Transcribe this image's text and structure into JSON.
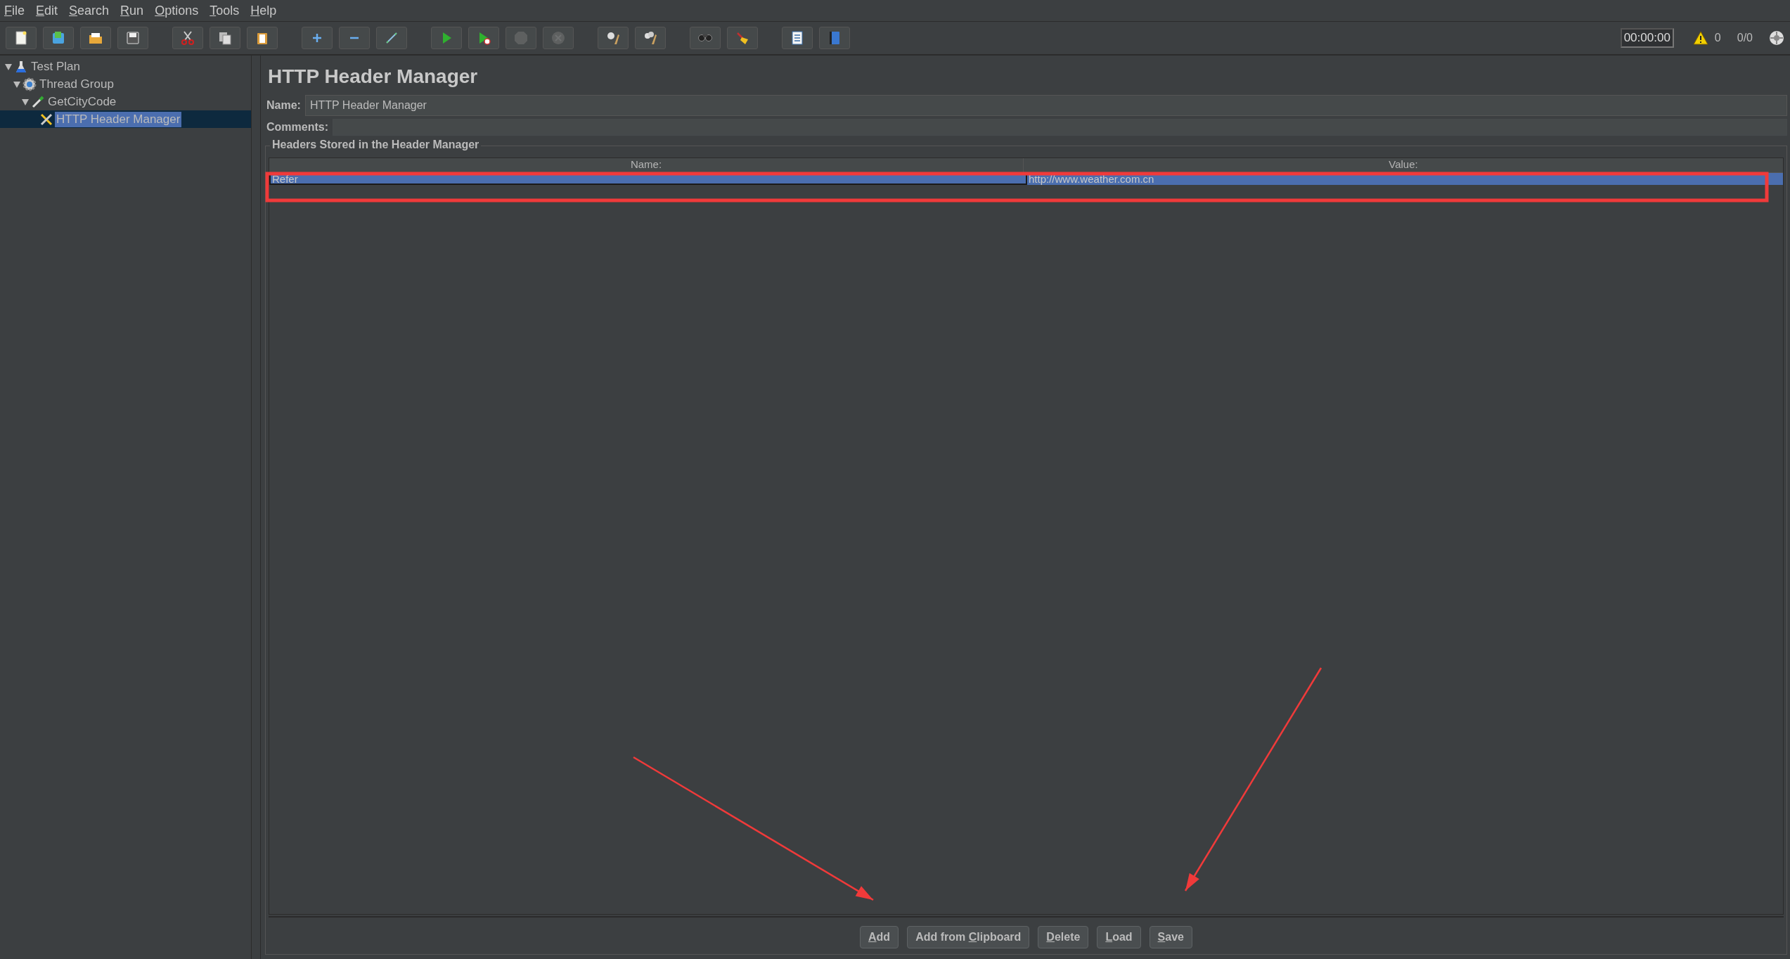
{
  "menu": [
    {
      "key": "F",
      "rest": "ile"
    },
    {
      "key": "E",
      "rest": "dit"
    },
    {
      "key": "S",
      "rest": "earch"
    },
    {
      "key": "R",
      "rest": "un"
    },
    {
      "key": "O",
      "rest": "ptions"
    },
    {
      "key": "T",
      "rest": "ools"
    },
    {
      "key": "H",
      "rest": "elp"
    }
  ],
  "toolbar": [
    [
      {
        "disabled": false
      },
      {
        "disabled": false
      },
      {
        "disabled": false
      },
      {
        "disabled": false
      }
    ],
    [
      {
        "disabled": false
      },
      {
        "disabled": false
      },
      {
        "disabled": false
      }
    ],
    [
      {
        "disabled": false
      },
      {
        "disabled": false
      },
      {
        "disabled": false
      }
    ],
    [
      {
        "disabled": false
      },
      {
        "disabled": false
      },
      {
        "disabled": true
      },
      {
        "disabled": true
      }
    ],
    [
      {
        "disabled": false
      },
      {
        "disabled": false
      }
    ],
    [
      {
        "disabled": false
      },
      {
        "disabled": false
      }
    ],
    [
      {
        "disabled": false
      },
      {
        "disabled": false
      }
    ]
  ],
  "status": {
    "timer": "00:00:00",
    "warnings": "0",
    "threads": "0/0"
  },
  "tree": [
    {
      "kind": "test_plan",
      "label": "Test Plan",
      "expanded": true,
      "selected": false,
      "children": [
        {
          "kind": "thread_group",
          "label": "Thread Group",
          "expanded": true,
          "selected": false,
          "children": [
            {
              "kind": "sampler",
              "label": "GetCityCode",
              "expanded": true,
              "selected": false,
              "children": [
                {
                  "kind": "config",
                  "label": "HTTP Header Manager",
                  "selected": true
                }
              ]
            }
          ]
        }
      ]
    }
  ],
  "panel": {
    "title": "HTTP Header Manager",
    "name_label": "Name:",
    "name_value": "HTTP Header Manager",
    "comments_label": "Comments:",
    "group_title": "Headers Stored in the Header Manager"
  },
  "table": {
    "columns": [
      "Name:",
      "Value:"
    ],
    "rows": [
      {
        "cells": [
          "Refer",
          "http://www.weather.com.cn"
        ],
        "selected": true
      }
    ]
  },
  "buttons": [
    {
      "key": "A",
      "post": "dd"
    },
    {
      "pre": "Add from ",
      "key": "C",
      "post": "lipboard"
    },
    {
      "key": "D",
      "post": "elete"
    },
    {
      "key": "L",
      "post": "oad"
    },
    {
      "key": "S",
      "post": "ave"
    }
  ],
  "annotations": [
    {
      "kind": "box"
    },
    {
      "kind": "arrow"
    },
    {
      "kind": "arrow"
    }
  ]
}
